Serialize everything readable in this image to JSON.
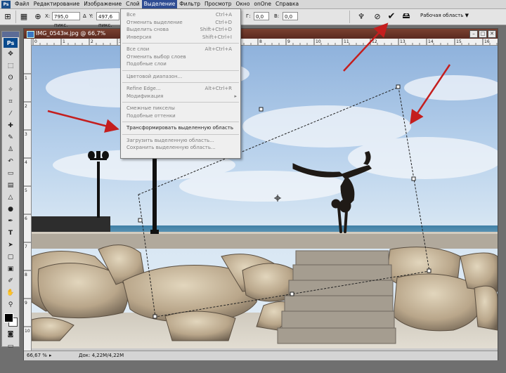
{
  "menubar": {
    "logo": "Ps",
    "items": [
      "Файл",
      "Редактирование",
      "Изображение",
      "Слой",
      "Выделение",
      "Фильтр",
      "Просмотр",
      "Окно",
      "onOne",
      "Справка"
    ],
    "active_index": 4
  },
  "options": {
    "x_label": "X:",
    "x_value": "795,0 пикс.",
    "y_label": "Y:",
    "y_value": "497,6 пикс.",
    "rot_label": "Г:",
    "rot_value": "0,0",
    "v_label": "В:",
    "v_value": "0,0",
    "workspace_label": "Рабочая область"
  },
  "toolbox": {
    "badge": "Ps"
  },
  "document": {
    "title": "IMG_0543м.jpg @ 66,7%",
    "ruler_h_labels": [
      "0",
      "1",
      "2",
      "3",
      "4",
      "5",
      "6",
      "7",
      "8",
      "9",
      "10",
      "11",
      "12",
      "13",
      "14",
      "15",
      "16"
    ],
    "ruler_v_labels": [
      "1",
      "2",
      "3",
      "4",
      "5",
      "6",
      "7",
      "8",
      "9",
      "10"
    ],
    "zoom": "66,67 %",
    "doc_info": "Док: 4,22M/4,22M"
  },
  "dropdown": {
    "items": [
      {
        "label": "Все",
        "shortcut": "Ctrl+A",
        "enabled": false
      },
      {
        "label": "Отменить выделение",
        "shortcut": "Ctrl+D",
        "enabled": false
      },
      {
        "label": "Выделить снова",
        "shortcut": "Shift+Ctrl+D",
        "enabled": false
      },
      {
        "label": "Инверсия",
        "shortcut": "Shift+Ctrl+I",
        "enabled": false
      },
      {
        "separator": true
      },
      {
        "label": "Все слои",
        "shortcut": "Alt+Ctrl+A",
        "enabled": false
      },
      {
        "label": "Отменить выбор слоев",
        "shortcut": "",
        "enabled": false
      },
      {
        "label": "Подобные слои",
        "shortcut": "",
        "enabled": false
      },
      {
        "separator": true
      },
      {
        "label": "Цветовой диапазон...",
        "shortcut": "",
        "enabled": false
      },
      {
        "separator": true
      },
      {
        "label": "Refine Edge...",
        "shortcut": "Alt+Ctrl+R",
        "enabled": false
      },
      {
        "label": "Модификация",
        "shortcut": "",
        "enabled": false,
        "submenu": true
      },
      {
        "separator": true
      },
      {
        "label": "Смежные пикселы",
        "shortcut": "",
        "enabled": false
      },
      {
        "label": "Подобные оттенки",
        "shortcut": "",
        "enabled": false
      },
      {
        "separator": true
      },
      {
        "label": "Трансформировать выделенную область",
        "shortcut": "",
        "enabled": true
      },
      {
        "separator": true
      },
      {
        "label": "Загрузить выделенную область...",
        "shortcut": "",
        "enabled": false
      },
      {
        "label": "Сохранить выделенную область...",
        "shortcut": "",
        "enabled": false
      }
    ]
  },
  "colors": {
    "menu_active": "#2e4c93",
    "title_bar": "#6a3427",
    "annotation_arrow": "#c41e1e"
  }
}
